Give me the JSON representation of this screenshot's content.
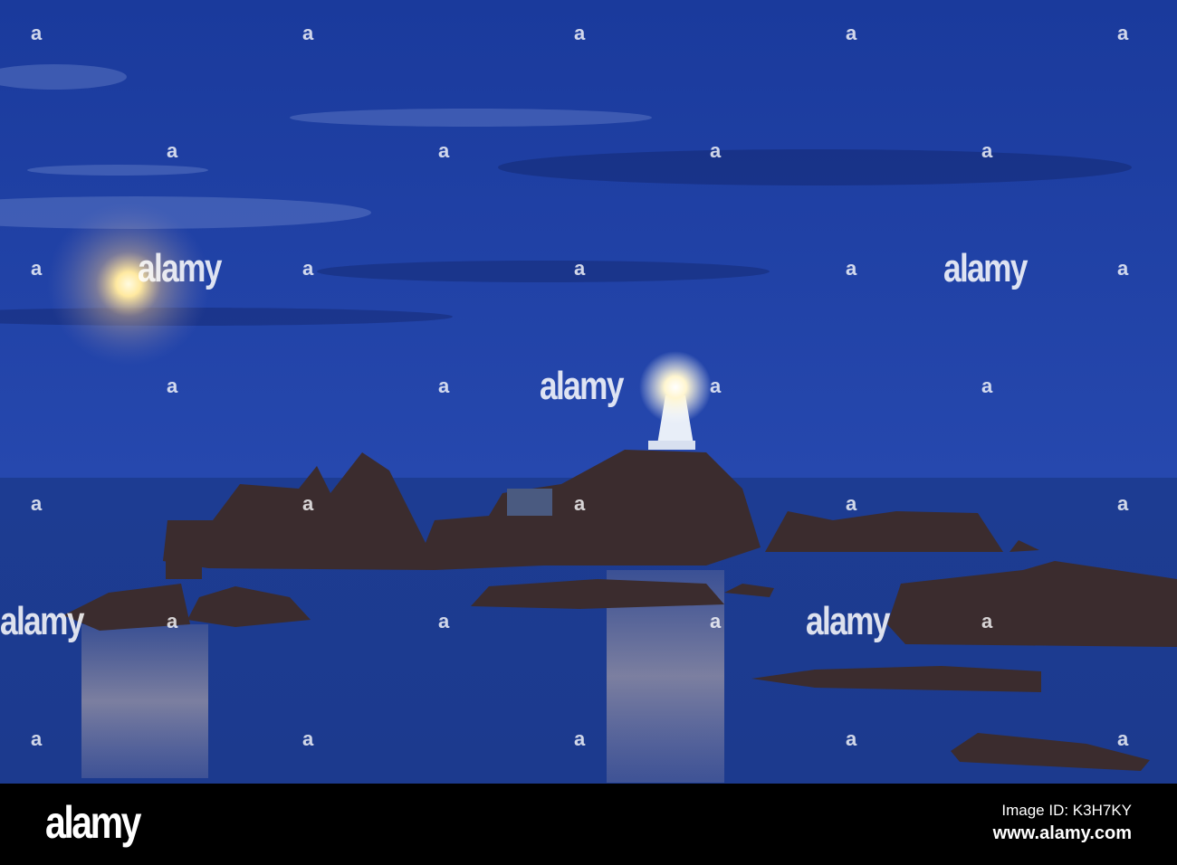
{
  "photo": {
    "subject": "lighthouse-moonrise",
    "watermark": "alamy"
  },
  "footer": {
    "logo": "alamy",
    "image_id": "Image ID: K3H7KY",
    "site": "www.alamy.com"
  },
  "colors": {
    "sky_top": "#1b3a9e",
    "horizon": "#2a4cb0",
    "sea": "#1f3f98",
    "rock": "#3b2c2e"
  }
}
